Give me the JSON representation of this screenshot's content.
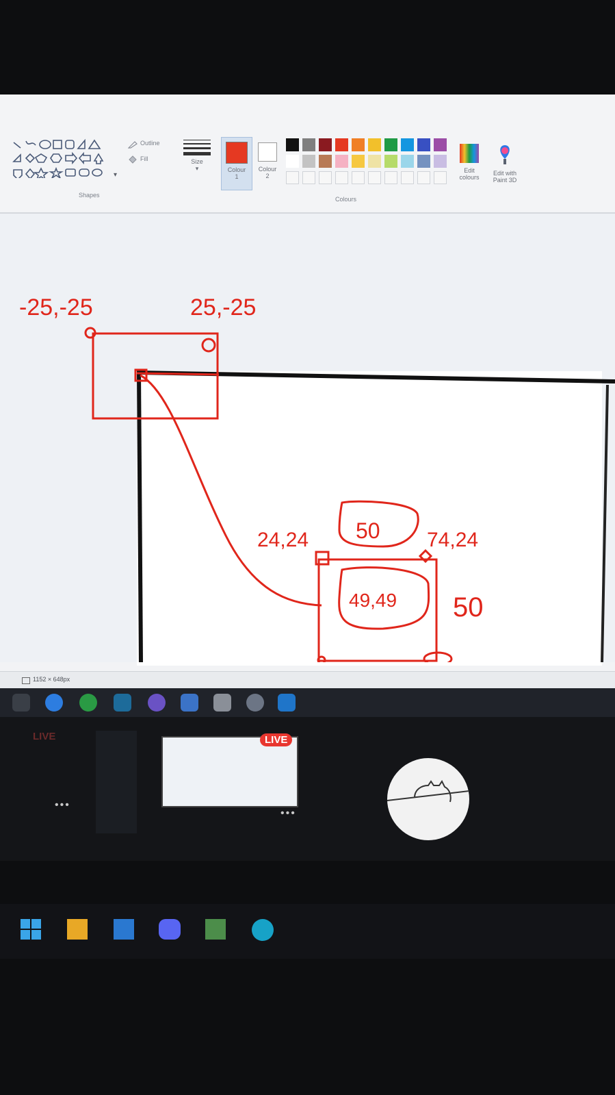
{
  "ribbon": {
    "shapes_label": "Shapes",
    "outline_label": "Outline",
    "fill_label": "Fill",
    "size_label": "Size",
    "colour1_label": "Colour",
    "colour1_num": "1",
    "colour2_label": "Colour",
    "colour2_num": "2",
    "colours_label": "Colours",
    "edit_colours_label": "Edit colours",
    "edit_paint3d_label": "Edit with Paint 3D",
    "colour1_value": "#e53922",
    "colour2_value": "#ffffff",
    "palette_row1": [
      "#111111",
      "#7f7f7f",
      "#8a1a20",
      "#e53922",
      "#f07f25",
      "#f2c02b",
      "#1f9a45",
      "#1496e0",
      "#3850c2",
      "#9b4da6"
    ],
    "palette_row2": [
      "#ffffff",
      "#c3c3c3",
      "#b87a56",
      "#f5b1c3",
      "#f6c841",
      "#efe3a5",
      "#b6db6a",
      "#9bd6ea",
      "#7592c0",
      "#c9bde3"
    ]
  },
  "canvas_annotations": {
    "top_left": "-25,-25",
    "top_right": "25,-25",
    "inner_left": "24,24",
    "inner_top_box": "50",
    "inner_right": "74,24",
    "inner_center": "49,49",
    "side_value": "50"
  },
  "status": {
    "dimensions": "1152 × 648px"
  },
  "stream": {
    "live_left": "LIVE",
    "live_center": "LIVE"
  }
}
